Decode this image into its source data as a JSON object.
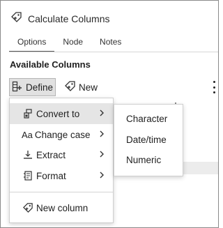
{
  "window": {
    "title": "Calculate Columns"
  },
  "tabs": [
    {
      "label": "Options",
      "active": true
    },
    {
      "label": "Node",
      "active": false
    },
    {
      "label": "Notes",
      "active": false
    }
  ],
  "section": {
    "title": "Available Columns"
  },
  "toolbar": {
    "define_label": "Define",
    "new_label": "New"
  },
  "menu": {
    "items": [
      {
        "label": "Convert to",
        "icon": "convert-icon",
        "has_submenu": true,
        "highlighted": true
      },
      {
        "label": "Change case",
        "icon": "change-case-icon",
        "icon_text": "Aa",
        "has_submenu": true
      },
      {
        "label": "Extract",
        "icon": "extract-icon",
        "has_submenu": true
      },
      {
        "label": "Format",
        "icon": "format-icon",
        "has_submenu": true
      },
      {
        "label": "New column",
        "icon": "new-column-icon",
        "has_submenu": false
      }
    ]
  },
  "submenu": {
    "items": [
      {
        "label": "Character"
      },
      {
        "label": "Date/time"
      },
      {
        "label": "Numeric"
      }
    ]
  },
  "colors": {
    "highlight": "#e5e5e5",
    "pressed": "#e1e1e1",
    "border": "#cfcfcf"
  }
}
